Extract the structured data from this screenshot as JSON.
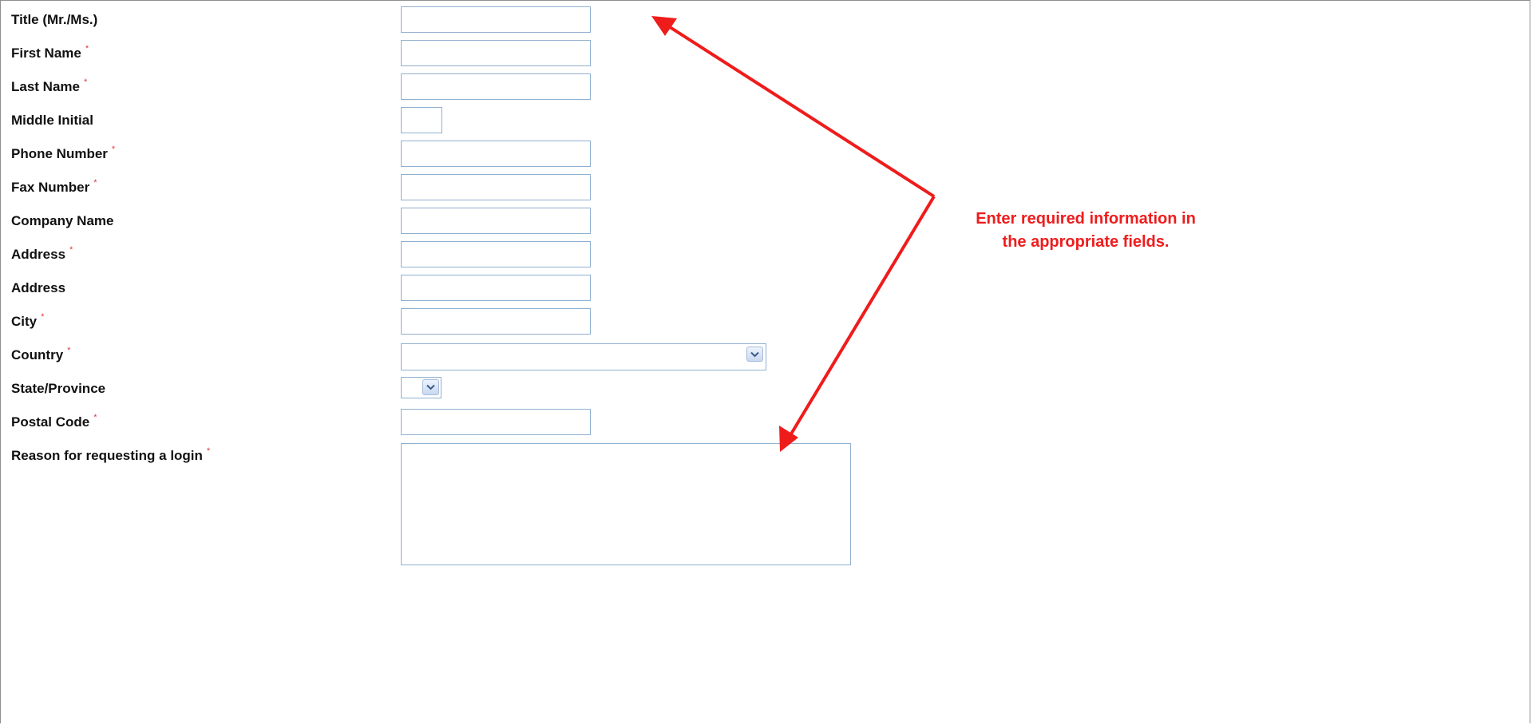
{
  "form": {
    "fields": [
      {
        "label": "Title (Mr./Ms.)",
        "required": false,
        "value": ""
      },
      {
        "label": "First Name",
        "required": true,
        "value": ""
      },
      {
        "label": "Last Name",
        "required": true,
        "value": ""
      },
      {
        "label": "Middle Initial",
        "required": false,
        "value": ""
      },
      {
        "label": "Phone Number",
        "required": true,
        "value": ""
      },
      {
        "label": "Fax Number",
        "required": true,
        "value": ""
      },
      {
        "label": "Company Name",
        "required": false,
        "value": ""
      },
      {
        "label": "Address",
        "required": true,
        "value": ""
      },
      {
        "label": "Address",
        "required": false,
        "value": ""
      },
      {
        "label": "City",
        "required": true,
        "value": ""
      },
      {
        "label": "Country",
        "required": true,
        "value": ""
      },
      {
        "label": "State/Province",
        "required": false,
        "value": ""
      },
      {
        "label": "Postal Code",
        "required": true,
        "value": ""
      },
      {
        "label": "Reason for requesting a login",
        "required": true,
        "value": ""
      }
    ],
    "required_marker": "*"
  },
  "annotation": {
    "text_line1": "Enter required information in",
    "text_line2": "the appropriate fields.",
    "color": "#ef1c1c"
  },
  "icons": {
    "dropdown": "chevron-down-icon"
  },
  "colors": {
    "field_border": "#8fb0d0",
    "required_asterisk": "#e33a3a",
    "label_text": "#111111"
  }
}
